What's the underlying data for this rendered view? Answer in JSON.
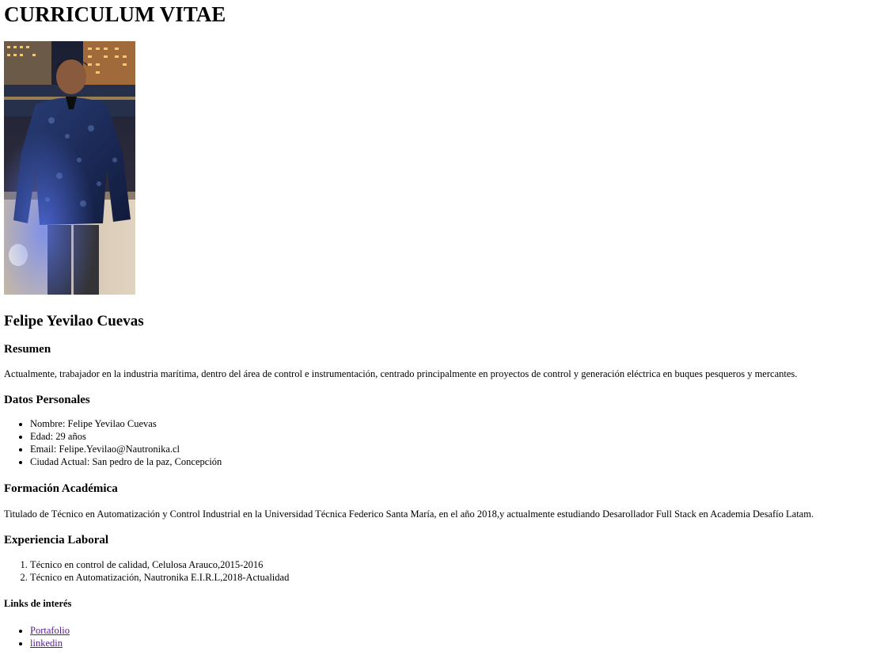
{
  "page": {
    "title": "CURRICULUM VITAE",
    "name": "Felipe Yevilao Cuevas"
  },
  "photo": {
    "icon": "person-photo"
  },
  "resumen": {
    "title": "Resumen",
    "text": "Actualmente, trabajador en la industria marítima, dentro del área de control e instrumentación, centrado principalmente en proyectos de control y generación eléctrica en buques pesqueros y mercantes."
  },
  "datos": {
    "title": "Datos Personales",
    "items": [
      "Nombre: Felipe Yevilao Cuevas",
      "Edad: 29 años",
      "Email: Felipe.Yevilao@Nautronika.cl",
      "Ciudad Actual: San pedro de la paz, Concepción"
    ]
  },
  "formacion": {
    "title": "Formación Académica",
    "text": "Titulado de Técnico en Automatización y Control Industrial en la Universidad Técnica Federico Santa María, en el año 2018,y actualmente estudiando Desarollador Full Stack en Academia Desafío Latam."
  },
  "experiencia": {
    "title": "Experiencia Laboral",
    "items": [
      "Técnico en control de calidad, Celulosa Arauco,2015-2016",
      "Técnico en Automatización, Nautronika E.I.R.L,2018-Actualidad"
    ]
  },
  "links": {
    "title": "Links de interés",
    "items": [
      "Portafolio",
      "linkedin"
    ]
  },
  "colors": {
    "link_visited": "#551a8b",
    "text": "#000000",
    "background": "#ffffff"
  }
}
